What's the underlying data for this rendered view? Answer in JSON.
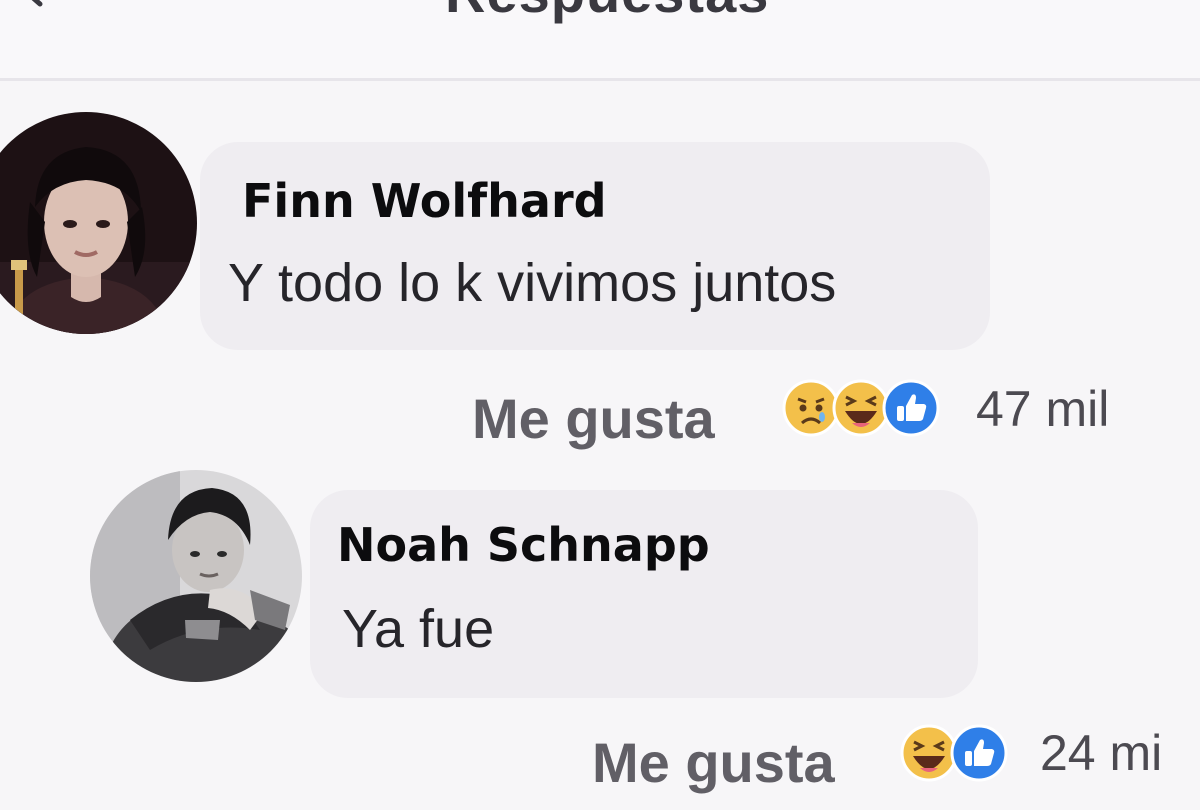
{
  "header": {
    "title": "Respuestas",
    "back_icon": "back-arrow-icon"
  },
  "comments": [
    {
      "author": "Finn Wolfhard",
      "text": "Y todo lo k vivimos juntos",
      "like_label": "Me gusta",
      "reactions": [
        "sad-reaction-icon",
        "haha-reaction-icon",
        "like-reaction-icon"
      ],
      "reaction_count": "47 mil"
    },
    {
      "author": "Noah Schnapp",
      "text": "Ya fue",
      "like_label": "Me gusta",
      "reactions": [
        "haha-reaction-icon",
        "like-reaction-icon"
      ],
      "reaction_count": "24 mi"
    }
  ],
  "colors": {
    "background": "#f7f6f8",
    "bubble": "#efedf1",
    "like_blue": "#2f7fe8",
    "emoji_yellow": "#f3c04a"
  }
}
